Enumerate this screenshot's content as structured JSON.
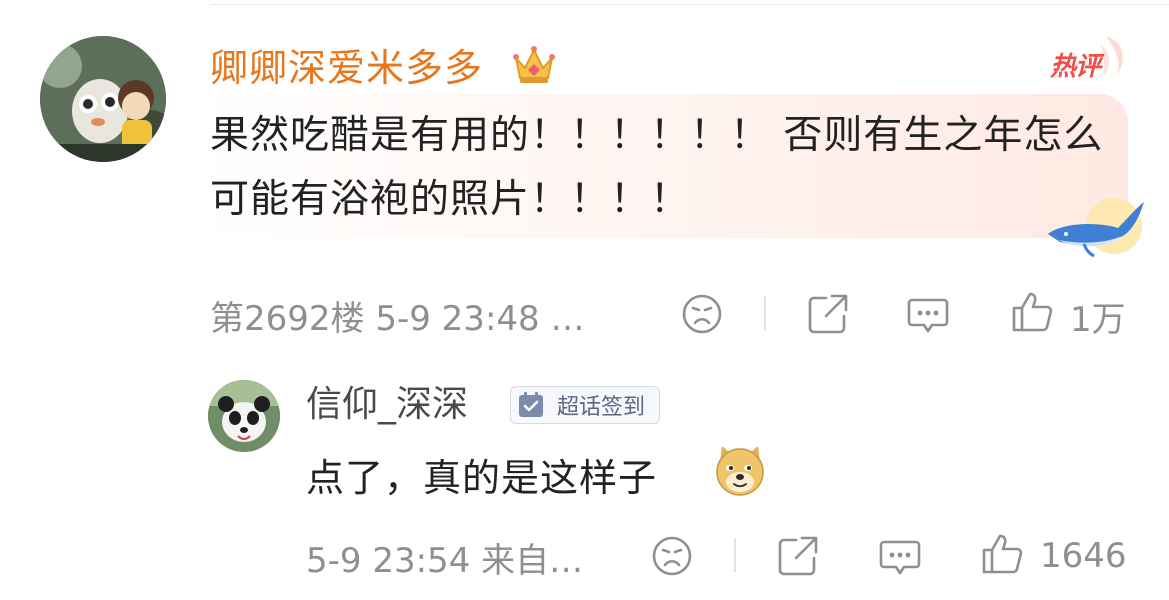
{
  "main_comment": {
    "username": "卿卿深爱米多多",
    "badge_text": "热评",
    "text": "果然吃醋是有用的！！！！！！ 否则有生之年怎么可能有浴袍的照片！！！！",
    "floor_time": "第2692楼 5-9 23:48 …",
    "like_count": "1万"
  },
  "reply": {
    "username": "信仰_深深",
    "badge_label": "超话签到",
    "text": "点了，真的是这样子",
    "time_source": "5-9 23:54 来自…",
    "like_count": "1646"
  },
  "colors": {
    "username_orange": "#e8761c",
    "hot_red": "#f04e48",
    "meta_gray": "#8f8f8f"
  },
  "icons": [
    "crown-icon",
    "hot-comment-badge",
    "whale-icon",
    "dislike-face-icon",
    "share-icon",
    "comment-icon",
    "thumbs-up-icon",
    "check-badge-icon",
    "doge-emoji"
  ]
}
